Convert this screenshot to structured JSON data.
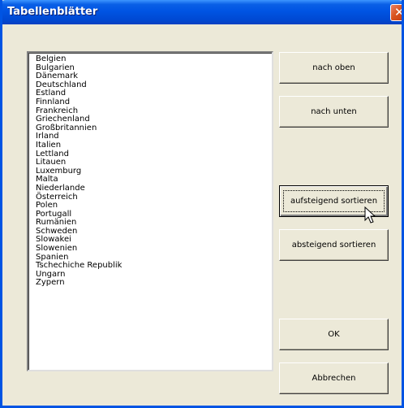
{
  "window": {
    "title": "Tabellenblätter"
  },
  "titlebar": {
    "close_icon": "close-icon",
    "close_glyph": "✕"
  },
  "countries": [
    "Belgien",
    "Bulgarien",
    "Dänemark",
    "Deutschland",
    "Estland",
    "Finnland",
    "Frankreich",
    "Griechenland",
    "Großbritannien",
    "Irland",
    "Italien",
    "Lettland",
    "Litauen",
    "Luxemburg",
    "Malta",
    "Niederlande",
    "Österreich",
    "Polen",
    "Portugall",
    "Rumänien",
    "Schweden",
    "Slowakei",
    "Slowenien",
    "Spanien",
    "Tschechiche Republik",
    "Ungarn",
    "Zypern"
  ],
  "buttons": {
    "up": "nach oben",
    "down": "nach unten",
    "sort_asc": "aufsteigend sortieren",
    "sort_desc": "absteigend sortieren",
    "ok": "OK",
    "cancel": "Abbrechen"
  },
  "colors": {
    "titlebar": "#0054e3",
    "dialog_bg": "#ece9d8",
    "close_button": "#d9541f"
  },
  "cursor_icon": "mouse-pointer-icon"
}
